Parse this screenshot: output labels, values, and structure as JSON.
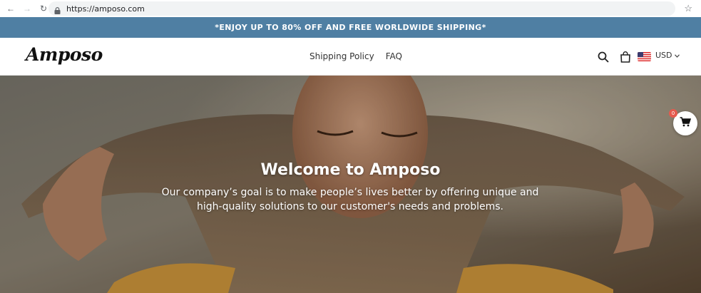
{
  "browser": {
    "url": "https://amposo.com",
    "icons": [
      "back-arrow-icon",
      "forward-arrow-icon",
      "reload-icon",
      "lock-icon",
      "star-icon"
    ]
  },
  "announcement": {
    "text": "*ENJOY UP TO 80% OFF AND FREE WORLDWIDE SHIPPING*",
    "background": "#4f7fa3"
  },
  "header": {
    "logo": "Amposo",
    "nav": [
      {
        "label": "Shipping Policy"
      },
      {
        "label": "FAQ"
      }
    ],
    "currency": "USD",
    "icons": [
      "search-icon",
      "shopping-bag-icon",
      "us-flag-icon",
      "chevron-down-icon"
    ]
  },
  "hero": {
    "title": "Welcome to Amposo",
    "subtitle": "Our company’s goal is to make people’s lives better by offering unique and high-quality solutions to our customer's needs and problems."
  },
  "floating_cart": {
    "count": "0",
    "icon": "cart-icon",
    "badge_color": "#e55a4e"
  }
}
